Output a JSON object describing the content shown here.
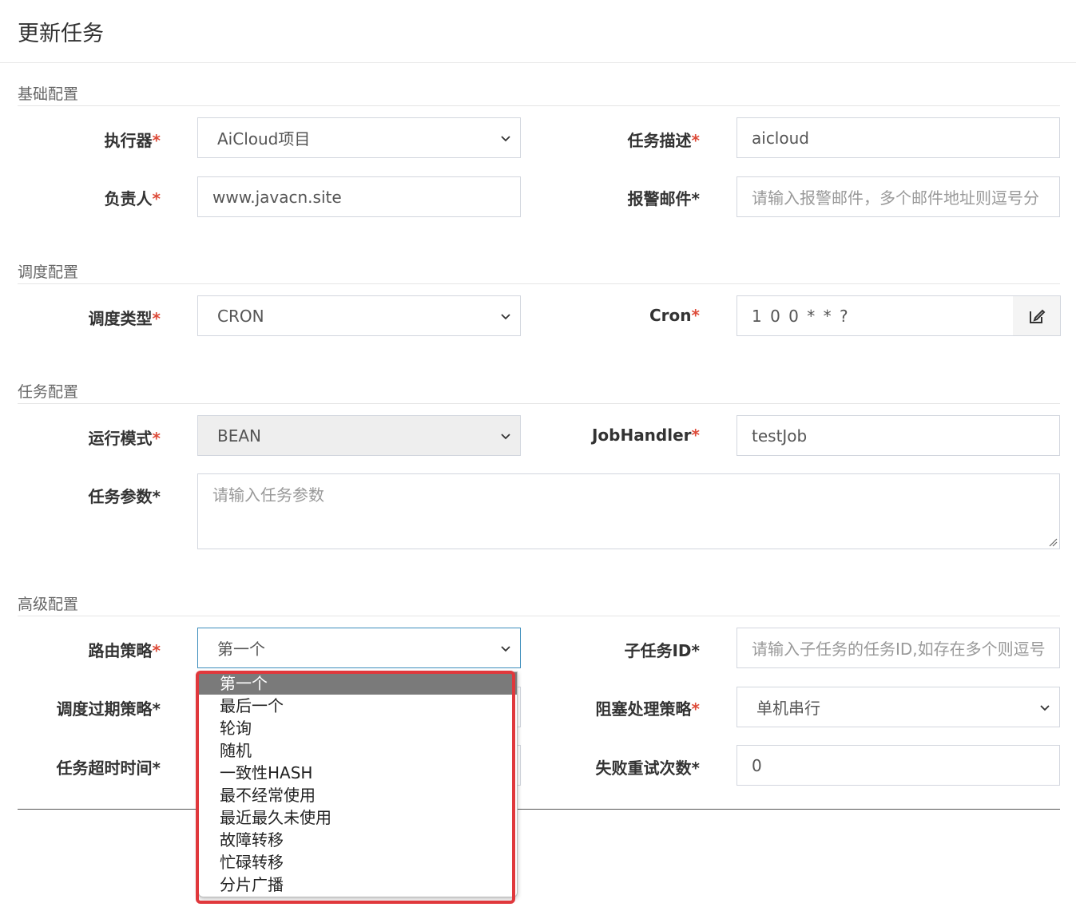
{
  "title": "更新任务",
  "required_mark": "*",
  "sections": {
    "basic": "基础配置",
    "schedule": "调度配置",
    "task": "任务配置",
    "advanced": "高级配置"
  },
  "fields": {
    "executor": {
      "label": "执行器",
      "value": "AiCloud项目"
    },
    "desc": {
      "label": "任务描述",
      "value": "aicloud"
    },
    "owner": {
      "label": "负责人",
      "value": "www.javacn.site"
    },
    "alarm_email": {
      "label": "报警邮件",
      "placeholder": "请输入报警邮件，多个邮件地址则逗号分"
    },
    "schedule_type": {
      "label": "调度类型",
      "value": "CRON"
    },
    "cron": {
      "label": "Cron",
      "value": "1 0 0 * * ?"
    },
    "glue_type": {
      "label": "运行模式",
      "value": "BEAN"
    },
    "job_handler": {
      "label": "JobHandler",
      "value": "testJob"
    },
    "params": {
      "label": "任务参数",
      "placeholder": "请输入任务参数"
    },
    "route": {
      "label": "路由策略",
      "value": "第一个"
    },
    "child_id": {
      "label": "子任务ID",
      "placeholder": "请输入子任务的任务ID,如存在多个则逗号"
    },
    "misfire": {
      "label": "调度过期策略"
    },
    "block": {
      "label": "阻塞处理策略",
      "value": "单机串行"
    },
    "timeout": {
      "label": "任务超时时间"
    },
    "retry": {
      "label": "失败重试次数",
      "value": "0"
    }
  },
  "route_options": [
    "第一个",
    "最后一个",
    "轮询",
    "随机",
    "一致性HASH",
    "最不经常使用",
    "最近最久未使用",
    "故障转移",
    "忙碌转移",
    "分片广播"
  ],
  "selected_route_index": 0,
  "colors": {
    "required": "#dd4b39",
    "highlight": "#e0383c",
    "focus": "#3c8dbc"
  }
}
